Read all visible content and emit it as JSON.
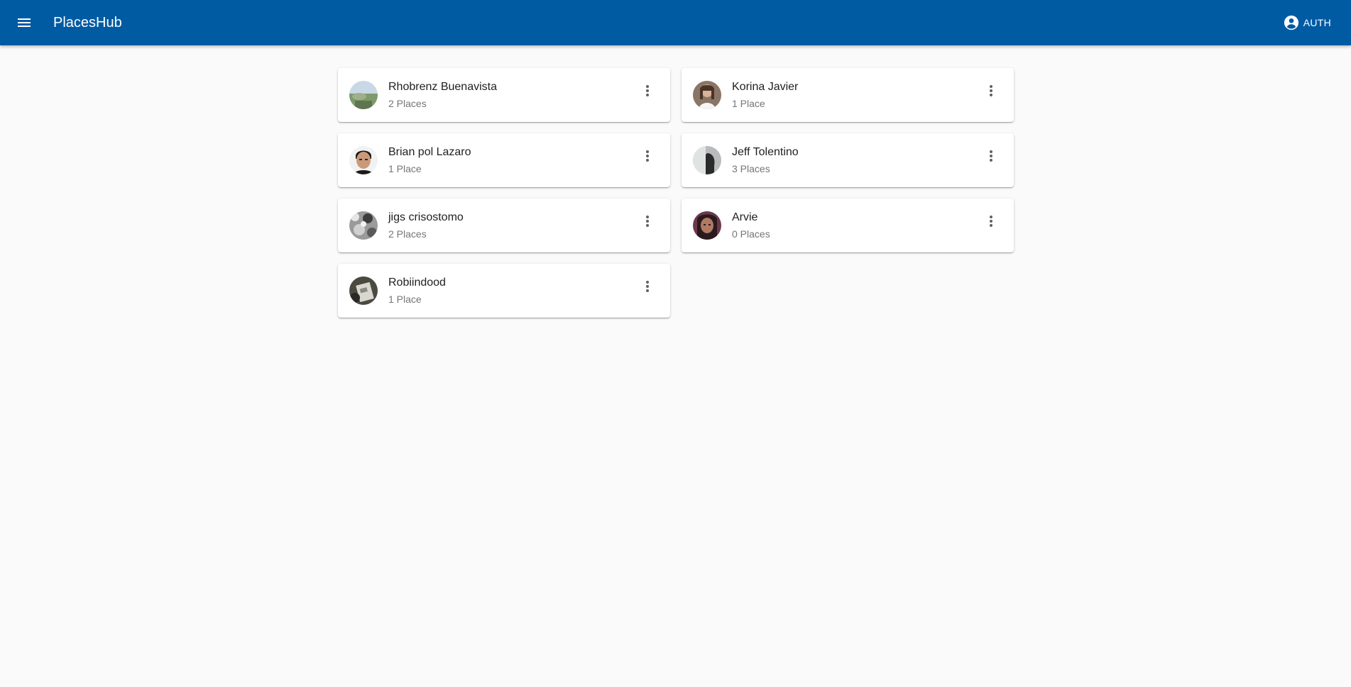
{
  "header": {
    "title": "PlacesHub",
    "menu_icon": "menu-icon",
    "auth_label": "AUTH",
    "auth_icon": "account-circle-icon",
    "background": "#005ba3"
  },
  "users": [
    {
      "name": "Rhobrenz Buenavista",
      "count": "2 Places"
    },
    {
      "name": "Korina Javier",
      "count": "1 Place"
    },
    {
      "name": "Brian pol Lazaro",
      "count": "1 Place"
    },
    {
      "name": "Jeff Tolentino",
      "count": "3 Places"
    },
    {
      "name": "jigs crisostomo",
      "count": "2 Places"
    },
    {
      "name": "Arvie",
      "count": "0 Places"
    },
    {
      "name": "Robiindood",
      "count": "1 Place"
    }
  ],
  "more_icon": "more-vert-icon"
}
